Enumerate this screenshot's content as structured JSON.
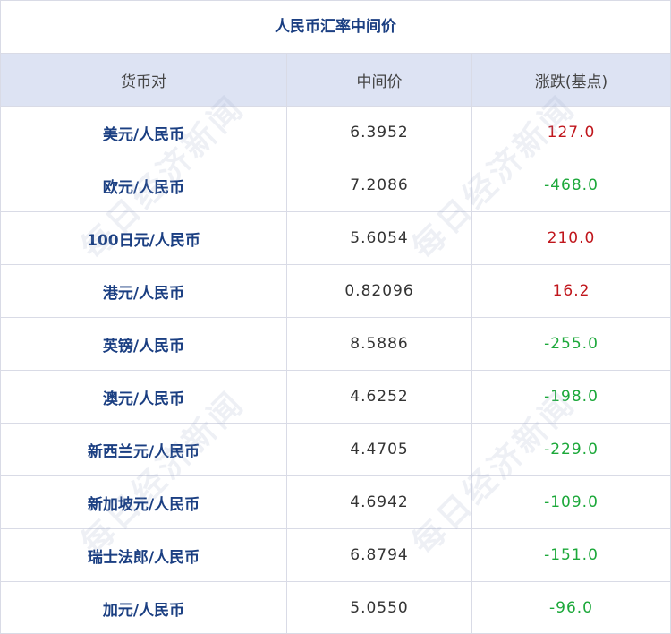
{
  "title": "人民币汇率中间价",
  "headers": {
    "pair": "货币对",
    "mid": "中间价",
    "change": "涨跌(基点)"
  },
  "rows": [
    {
      "pair": "美元/人民币",
      "mid": "6.3952",
      "change": "127.0",
      "direction": "up"
    },
    {
      "pair": "欧元/人民币",
      "mid": "7.2086",
      "change": "-468.0",
      "direction": "down"
    },
    {
      "pair": "100日元/人民币",
      "mid": "5.6054",
      "change": "210.0",
      "direction": "up"
    },
    {
      "pair": "港元/人民币",
      "mid": "0.82096",
      "change": "16.2",
      "direction": "up"
    },
    {
      "pair": "英镑/人民币",
      "mid": "8.5886",
      "change": "-255.0",
      "direction": "down"
    },
    {
      "pair": "澳元/人民币",
      "mid": "4.6252",
      "change": "-198.0",
      "direction": "down"
    },
    {
      "pair": "新西兰元/人民币",
      "mid": "4.4705",
      "change": "-229.0",
      "direction": "down"
    },
    {
      "pair": "新加坡元/人民币",
      "mid": "4.6942",
      "change": "-109.0",
      "direction": "down"
    },
    {
      "pair": "瑞士法郎/人民币",
      "mid": "6.8794",
      "change": "-151.0",
      "direction": "down"
    },
    {
      "pair": "加元/人民币",
      "mid": "5.0550",
      "change": "-96.0",
      "direction": "down"
    }
  ],
  "watermark": "每日经济新闻",
  "colors": {
    "title": "#1b3f82",
    "header_bg": "#dde3f3",
    "up": "#c0161c",
    "down": "#1ca83a",
    "border": "#d9dbe6"
  }
}
